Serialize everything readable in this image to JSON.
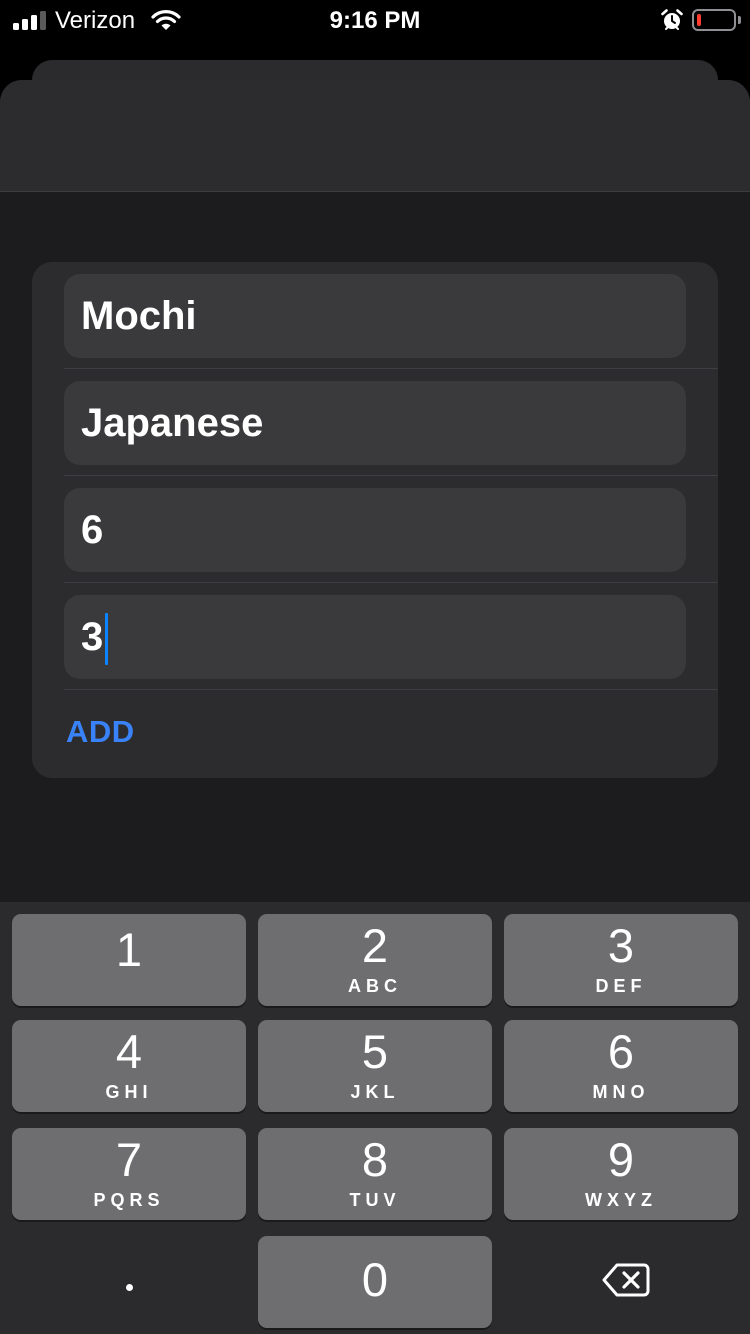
{
  "status_bar": {
    "carrier": "Verizon",
    "time": "9:16 PM",
    "battery_level": 0.1
  },
  "form": {
    "fields": [
      {
        "value": "Mochi"
      },
      {
        "value": "Japanese"
      },
      {
        "value": "6"
      },
      {
        "value": "3"
      }
    ],
    "add_label": "ADD"
  },
  "keyboard": {
    "keys": [
      {
        "num": "1",
        "letters": ""
      },
      {
        "num": "2",
        "letters": "ABC"
      },
      {
        "num": "3",
        "letters": "DEF"
      },
      {
        "num": "4",
        "letters": "GHI"
      },
      {
        "num": "5",
        "letters": "JKL"
      },
      {
        "num": "6",
        "letters": "MNO"
      },
      {
        "num": "7",
        "letters": "PQRS"
      },
      {
        "num": "8",
        "letters": "TUV"
      },
      {
        "num": "9",
        "letters": "WXYZ"
      },
      {
        "num": "0",
        "letters": ""
      }
    ],
    "decimal_key": ".",
    "delete_icon": "delete-backspace-icon"
  },
  "colors": {
    "accent": "#3a82f7",
    "cursor": "#0a84ff",
    "battery_low": "#ff3b30"
  }
}
